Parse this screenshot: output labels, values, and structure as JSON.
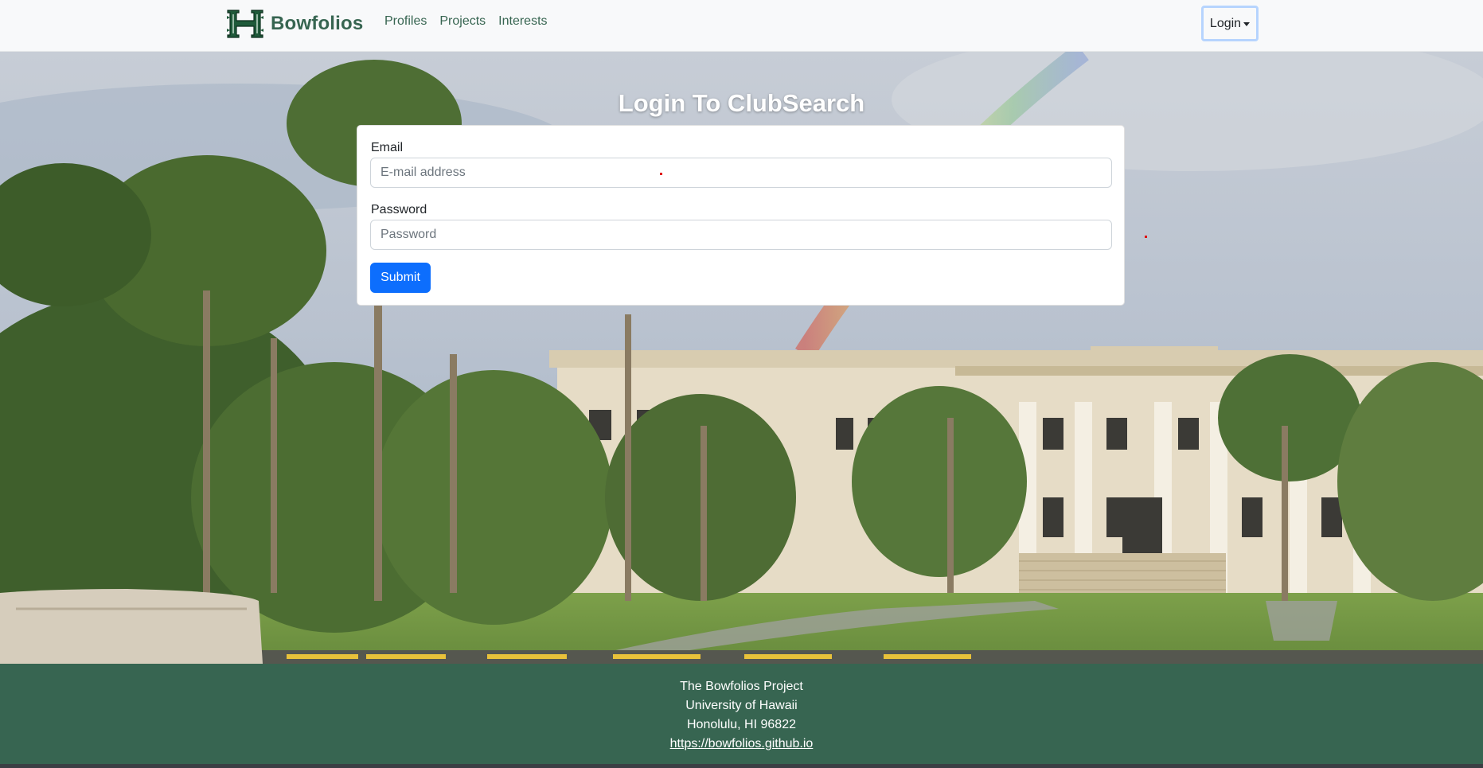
{
  "navbar": {
    "brand": "Bowfolios",
    "logo_icon": "hawaii-h-logo-icon",
    "links": [
      "Profiles",
      "Projects",
      "Interests"
    ],
    "login_label": "Login"
  },
  "hero": {
    "title": "Login To ClubSearch"
  },
  "form": {
    "email_label": "Email",
    "email_placeholder": "E-mail address",
    "email_value": "",
    "password_label": "Password",
    "password_placeholder": "Password",
    "password_value": "",
    "submit_label": "Submit"
  },
  "footer": {
    "line1": "The Bowfolios Project",
    "line2": "University of Hawaii",
    "line3": "Honolulu, HI 96822",
    "link": "https://bowfolios.github.io"
  },
  "colors": {
    "brand_green": "#376551",
    "primary_blue": "#0d6efd",
    "navbar_bg": "#f8f9fa"
  }
}
